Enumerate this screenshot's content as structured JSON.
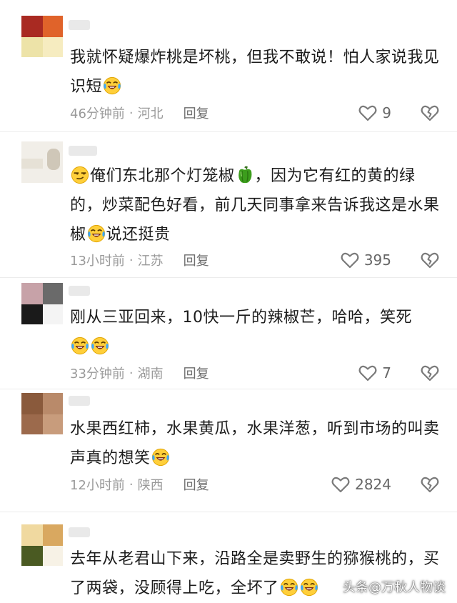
{
  "comments": [
    {
      "text_parts": [
        "我就怀疑爆炸桃是坏桃，但我不敢说！怕人家说我见识短"
      ],
      "time": "46分钟前",
      "region": "河北",
      "reply_label": "回复",
      "likes": "9"
    },
    {
      "text_parts": [
        "俺们东北那个灯笼椒",
        "，因为它有红的黄的绿的，炒菜配色好看，前几天同事拿来告诉我这是水果椒",
        "说还挺贵"
      ],
      "time": "13小时前",
      "region": "江苏",
      "reply_label": "回复",
      "likes": "395"
    },
    {
      "text_parts": [
        "刚从三亚回来，10快一斤的辣椒芒，哈哈，笑死"
      ],
      "time": "33分钟前",
      "region": "湖南",
      "reply_label": "回复",
      "likes": "7"
    },
    {
      "text_parts": [
        "水果西红柿，水果黄瓜，水果洋葱，听到市场的叫卖声真的想笑"
      ],
      "time": "12小时前",
      "region": "陕西",
      "reply_label": "回复",
      "likes": "2824"
    },
    {
      "text_parts": [
        "去年从老君山下来，沿路全是卖野生的猕猴桃的，买了两袋，没顾得上吃，全坏了"
      ]
    }
  ],
  "meta_separator": "·",
  "watermark": "头条@万秋人物谈",
  "icons": [
    "laugh-cry-emoji-icon",
    "smug-emoji-icon",
    "green-pepper-icon",
    "heart-icon",
    "broken-heart-icon"
  ]
}
